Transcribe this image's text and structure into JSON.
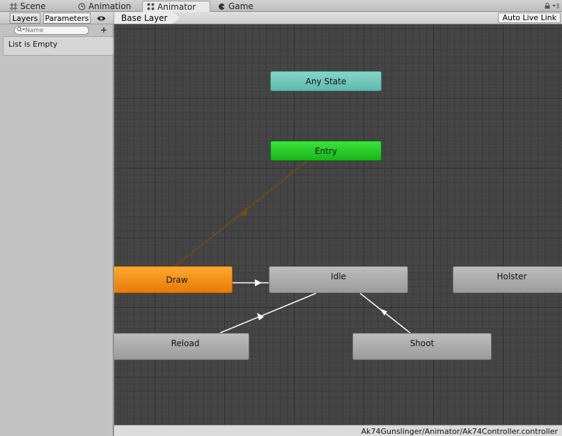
{
  "tabs": [
    {
      "label": "Scene",
      "icon": "scene-grid-icon"
    },
    {
      "label": "Animation",
      "icon": "clock-icon"
    },
    {
      "label": "Animator",
      "icon": "animator-icon",
      "active": true
    },
    {
      "label": "Game",
      "icon": "game-icon"
    }
  ],
  "left_panel": {
    "layers_label": "Layers",
    "parameters_label": "Parameters",
    "search_placeholder": "Name",
    "add_label": "+",
    "empty_text": "List is Empty"
  },
  "breadcrumb": {
    "base_layer": "Base Layer"
  },
  "toolbar": {
    "auto_live_link": "Auto Live Link"
  },
  "states": {
    "any_state": "Any State",
    "entry": "Entry",
    "draw": "Draw",
    "idle": "Idle",
    "holster": "Holster",
    "reload": "Reload",
    "shoot": "Shoot"
  },
  "colors": {
    "any_state": "#6cc4b9",
    "entry": "#21c321",
    "default_state": "#f08a14",
    "state": "#a8a8a8",
    "graph_bg": "#454545",
    "default_transition": "#7a4d07",
    "transition": "#ffffff"
  },
  "status": {
    "path": "Ak74Gunslinger/Animator/Ak74Controller.controller"
  }
}
